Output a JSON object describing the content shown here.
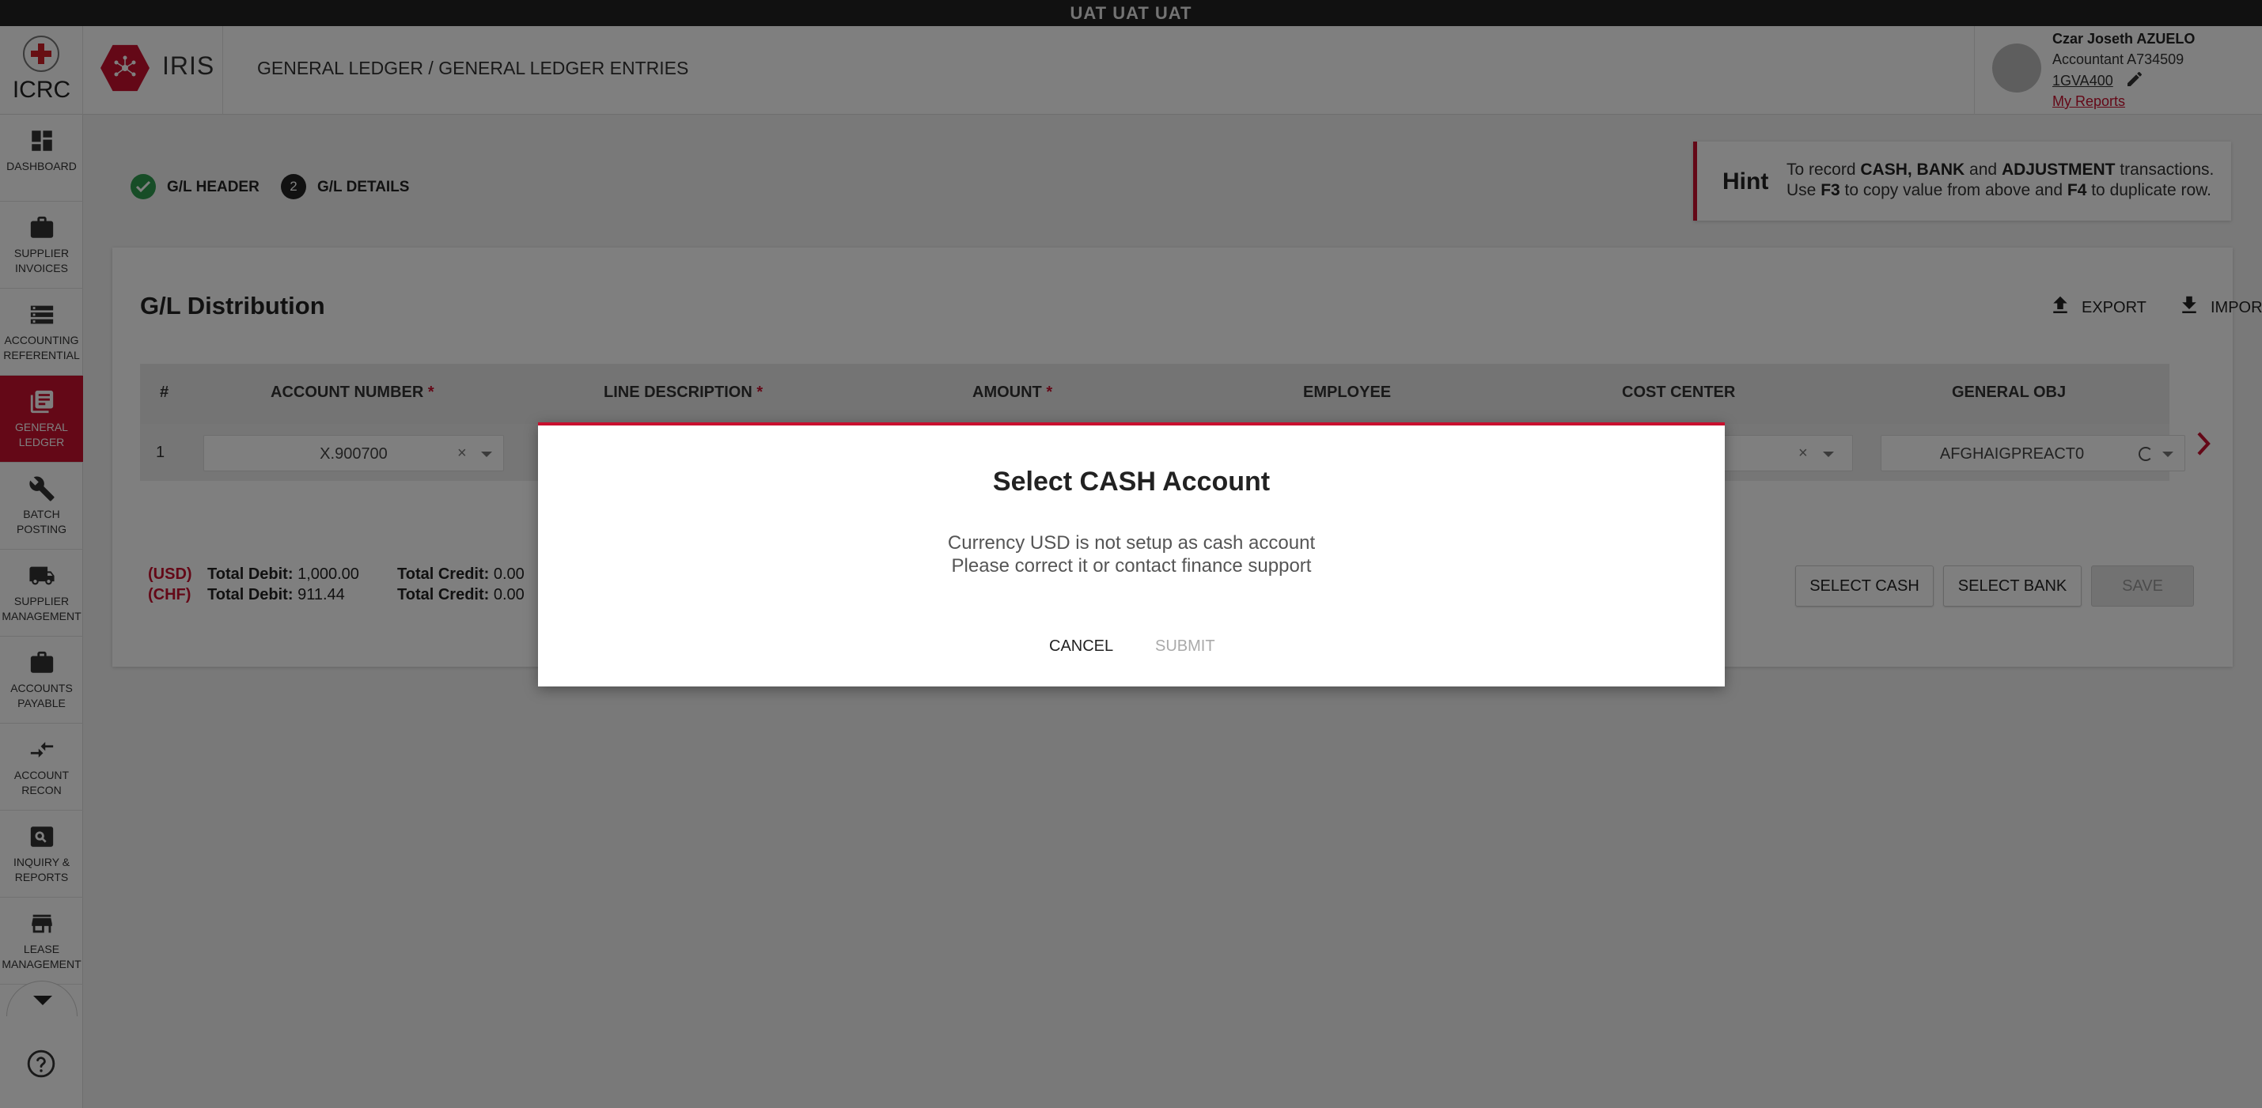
{
  "env_banner": "UAT UAT UAT",
  "brand": {
    "org": "ICRC",
    "app": "IRIS"
  },
  "breadcrumb": "GENERAL LEDGER / GENERAL LEDGER ENTRIES",
  "user": {
    "name": "Czar Joseth AZUELO",
    "role": "Accountant A734509",
    "code": "1GVA400",
    "reports_link": "My Reports"
  },
  "sidebar": {
    "items": [
      {
        "label": "DASHBOARD",
        "icon": "dashboard-icon",
        "active": false
      },
      {
        "label": "SUPPLIER\nINVOICES",
        "icon": "briefcase-icon",
        "active": false
      },
      {
        "label": "ACCOUNTING\nREFERENTIAL",
        "icon": "storage-icon",
        "active": false
      },
      {
        "label": "GENERAL\nLEDGER",
        "icon": "ledger-icon",
        "active": true
      },
      {
        "label": "BATCH\nPOSTING",
        "icon": "wrench-icon",
        "active": false
      },
      {
        "label": "SUPPLIER\nMANAGEMENT",
        "icon": "truck-icon",
        "active": false
      },
      {
        "label": "ACCOUNTS\nPAYABLE",
        "icon": "briefcase-icon",
        "active": false
      },
      {
        "label": "ACCOUNT\nRECON",
        "icon": "compare-arrows-icon",
        "active": false
      },
      {
        "label": "INQUIRY &\nREPORTS",
        "icon": "search-report-icon",
        "active": false
      },
      {
        "label": "LEASE\nMANAGEMENT",
        "icon": "store-icon",
        "active": false
      }
    ]
  },
  "stepper": {
    "step1_label": "G/L HEADER",
    "step2_number": "2",
    "step2_label": "G/L DETAILS"
  },
  "hint": {
    "title": "Hint",
    "line1_pre": "To record ",
    "line1_b1": "CASH, BANK",
    "line1_mid": " and ",
    "line1_b2": "ADJUSTMENT",
    "line1_post": " transactions.",
    "line2_pre": "Use ",
    "line2_b1": "F3",
    "line2_mid": " to copy value from above and ",
    "line2_b2": "F4",
    "line2_post": " to duplicate row."
  },
  "distribution": {
    "title": "G/L Distribution",
    "export_label": "EXPORT",
    "import_label": "IMPORT",
    "columns": {
      "num": "#",
      "account": "ACCOUNT NUMBER",
      "description": "LINE DESCRIPTION",
      "amount": "AMOUNT",
      "employee": "EMPLOYEE",
      "cost_center": "COST CENTER",
      "general_obj": "GENERAL OBJ"
    },
    "required_mark": "*",
    "row": {
      "num": "1",
      "account": "X.900700",
      "general_obj": "AFGHAIGPREACT0"
    },
    "totals": {
      "usd_cur": "(USD)",
      "usd_debit_label": "Total Debit:",
      "usd_debit": "1,000.00",
      "usd_credit_label": "Total Credit:",
      "usd_credit": "0.00",
      "chf_cur": "(CHF)",
      "chf_debit_label": "Total Debit:",
      "chf_debit": "911.44",
      "chf_credit_label": "Total Credit:",
      "chf_credit": "0.00"
    },
    "buttons": {
      "select_cash": "SELECT CASH",
      "select_bank": "SELECT BANK",
      "save": "SAVE"
    }
  },
  "modal": {
    "title": "Select CASH Account",
    "message_line1": "Currency USD is not setup as cash account",
    "message_line2": "Please correct it or contact finance support",
    "cancel_label": "CANCEL",
    "submit_label": "SUBMIT"
  },
  "colors": {
    "accent": "#c8102e",
    "success": "#2e9b4e",
    "env_bar": "#222222"
  }
}
